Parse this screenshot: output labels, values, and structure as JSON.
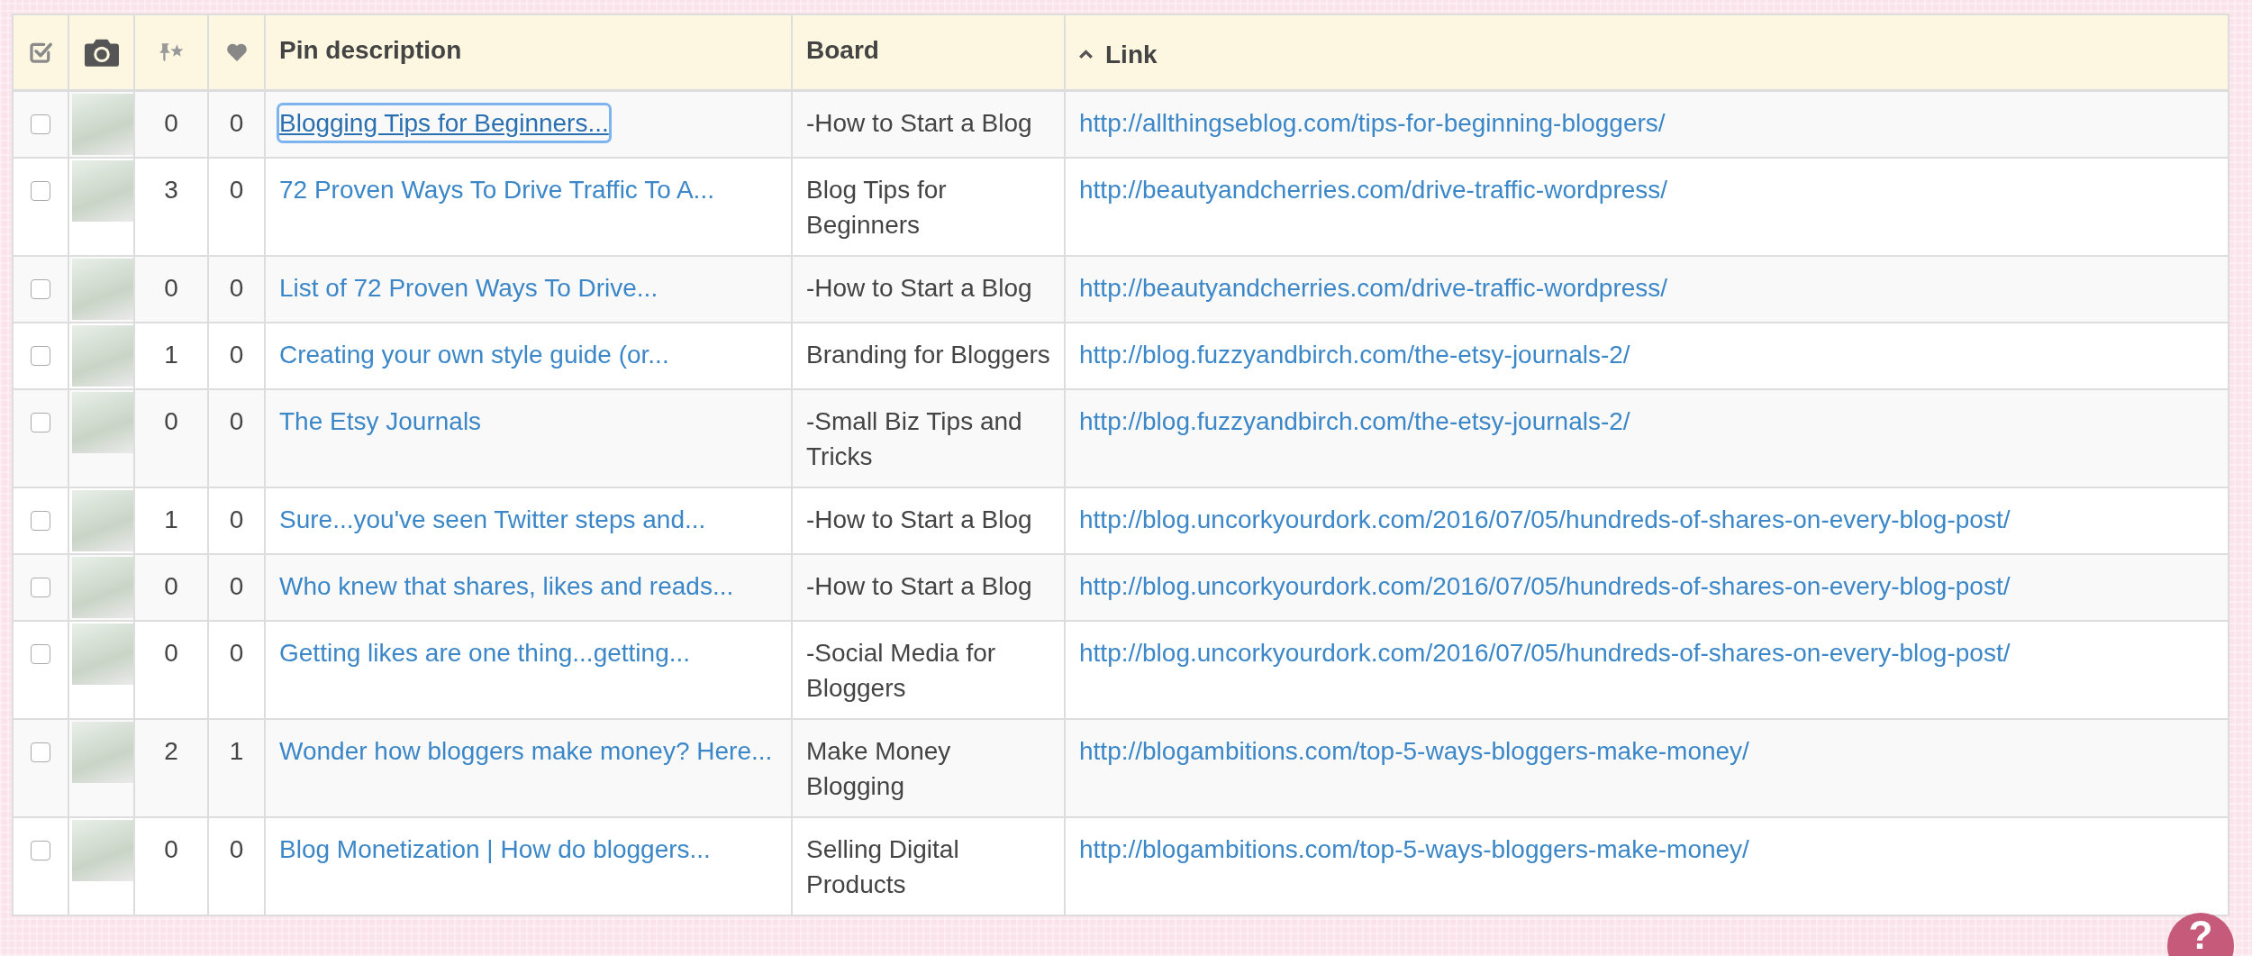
{
  "columns": [
    {
      "kind": "select-all"
    },
    {
      "kind": "photo"
    },
    {
      "kind": "repins"
    },
    {
      "kind": "likes"
    },
    {
      "kind": "text",
      "label": "Pin description",
      "sorted": false
    },
    {
      "kind": "text",
      "label": "Board",
      "sorted": false
    },
    {
      "kind": "text",
      "label": "Link",
      "sorted": true
    }
  ],
  "rows": [
    {
      "checked": false,
      "repins": "0",
      "likes": "0",
      "description": "Blogging Tips for Beginners...",
      "focused": true,
      "board": "-How to Start a Blog",
      "link": "http://allthingseblog.com/tips-for-beginning-bloggers/"
    },
    {
      "checked": false,
      "repins": "3",
      "likes": "0",
      "description": "72 Proven Ways To Drive Traffic To A...",
      "focused": false,
      "board": "Blog Tips for Beginners",
      "link": "http://beautyandcherries.com/drive-traffic-wordpress/"
    },
    {
      "checked": false,
      "repins": "0",
      "likes": "0",
      "description": "List of 72 Proven Ways To Drive...",
      "focused": false,
      "board": "-How to Start a Blog",
      "link": "http://beautyandcherries.com/drive-traffic-wordpress/"
    },
    {
      "checked": false,
      "repins": "1",
      "likes": "0",
      "description": "Creating your own style guide (or...",
      "focused": false,
      "board": "Branding for Bloggers",
      "link": "http://blog.fuzzyandbirch.com/the-etsy-journals-2/"
    },
    {
      "checked": false,
      "repins": "0",
      "likes": "0",
      "description": "The Etsy Journals",
      "focused": false,
      "board": "-Small Biz Tips and Tricks",
      "link": "http://blog.fuzzyandbirch.com/the-etsy-journals-2/"
    },
    {
      "checked": false,
      "repins": "1",
      "likes": "0",
      "description": "Sure...you've seen Twitter steps and...",
      "focused": false,
      "board": "-How to Start a Blog",
      "link": "http://blog.uncorkyourdork.com/2016/07/05/hundreds-of-shares-on-every-blog-post/"
    },
    {
      "checked": false,
      "repins": "0",
      "likes": "0",
      "description": "Who knew that shares, likes and reads...",
      "focused": false,
      "board": "-How to Start a Blog",
      "link": "http://blog.uncorkyourdork.com/2016/07/05/hundreds-of-shares-on-every-blog-post/"
    },
    {
      "checked": false,
      "repins": "0",
      "likes": "0",
      "description": "Getting likes are one thing...getting...",
      "focused": false,
      "board": "-Social Media for Bloggers",
      "link": "http://blog.uncorkyourdork.com/2016/07/05/hundreds-of-shares-on-every-blog-post/"
    },
    {
      "checked": false,
      "repins": "2",
      "likes": "1",
      "description": "Wonder how bloggers make money? Here...",
      "focused": false,
      "board": "Make Money Blogging",
      "link": "http://blogambitions.com/top-5-ways-bloggers-make-money/"
    },
    {
      "checked": false,
      "repins": "0",
      "likes": "0",
      "description": "Blog Monetization | How do bloggers...",
      "focused": false,
      "board": "Selling Digital Products",
      "link": "http://blogambitions.com/top-5-ways-bloggers-make-money/"
    }
  ],
  "help_button": {
    "label": "?"
  }
}
